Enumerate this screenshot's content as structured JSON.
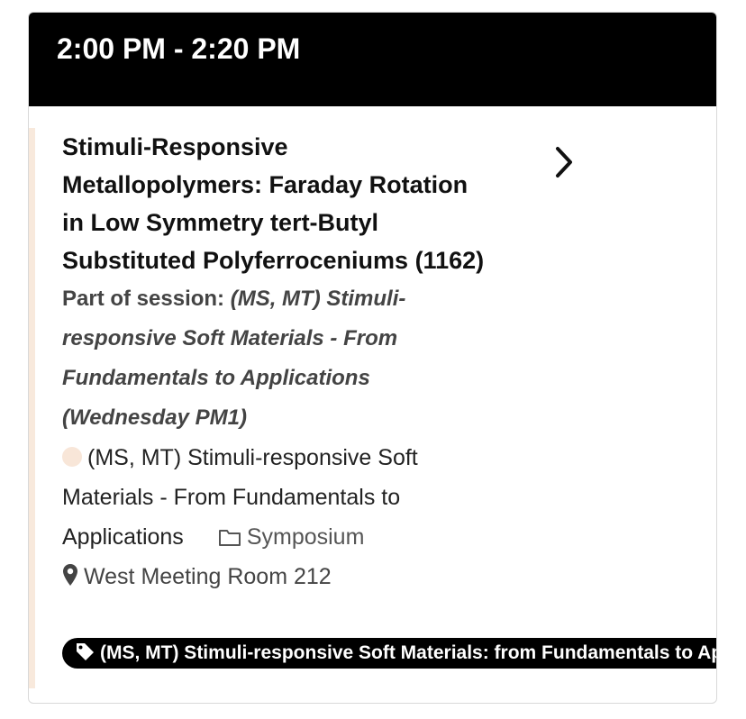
{
  "event": {
    "time_range": "2:00 PM - 2:20 PM",
    "title": "Stimuli-Responsive Metallopolymers: Faraday Rotation in Low Symmetry tert-Butyl Substituted Polyferroceniums (1162)",
    "session_prefix": "Part of session: ",
    "session_name": "(MS, MT) Stimuli-responsive Soft Materials - From Fundamentals to Applications (Wednesday PM1)",
    "track_name": "(MS, MT) Stimuli-responsive Soft Materials - From Fundamentals to Applications",
    "type": "Symposium",
    "location": "West Meeting Room 212",
    "tag": "(MS, MT) Stimuli-responsive Soft Materials: from Fundamentals to Applications"
  },
  "colors": {
    "header_bg": "#000000",
    "accent": "#f8e9dc",
    "tag_bg": "#000000"
  },
  "icons": {
    "chevron": "chevron-right-icon",
    "folder": "folder-icon",
    "pin": "map-pin-icon",
    "tag": "tag-icon"
  }
}
